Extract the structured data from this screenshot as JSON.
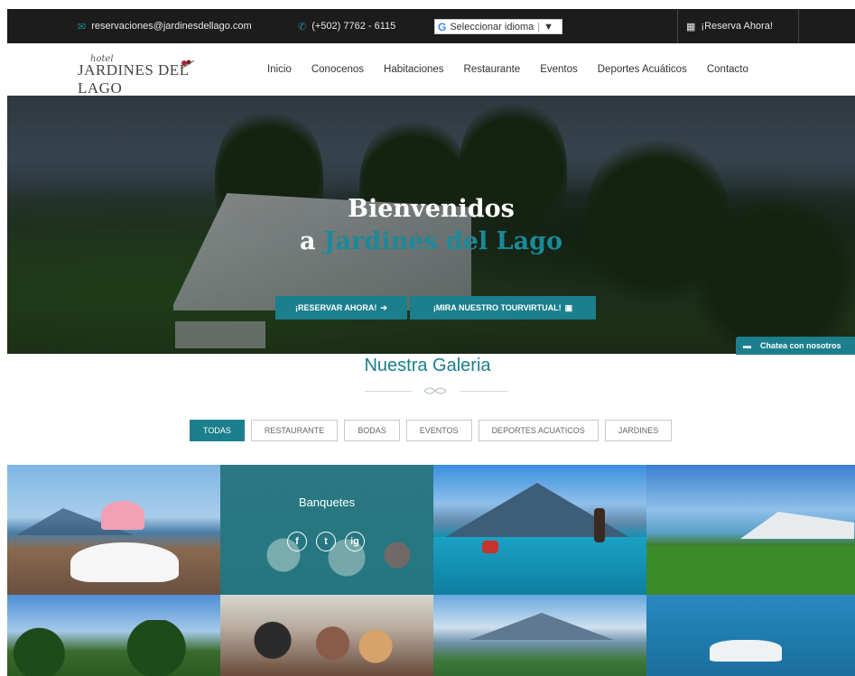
{
  "topbar": {
    "email": "reservaciones@jardinesdellago.com",
    "phone": "(+502) 7762 - 6115",
    "language_select": "Seleccionar idioma",
    "language_g": "G",
    "language_arrow": "▼",
    "reserve": "¡Reserva Ahora!"
  },
  "logo": {
    "script": "hotel",
    "word": "JARDINES DEL LAGO"
  },
  "nav": {
    "items": [
      "Inicio",
      "Conocenos",
      "Habitaciones",
      "Restaurante",
      "Eventos",
      "Deportes Acuáticos",
      "Contacto"
    ]
  },
  "hero": {
    "line1": "Bienvenidos",
    "line2_prefix": "a ",
    "line2_accent": "Jardines del Lago",
    "button_reserve": "¡RESERVAR AHORA!",
    "button_tour": "¡MIRA NUESTRO TOURVIRTUAL!"
  },
  "chat": {
    "label": "Chatea con nosotros"
  },
  "gallery": {
    "title": "Nuestra Galeria",
    "filters": [
      "TODAS",
      "RESTAURANTE",
      "BODAS",
      "EVENTOS",
      "DEPORTES ACUATICOS",
      "JARDINES"
    ],
    "active_filter": "TODAS",
    "hover_caption": "Banquetes",
    "socials": [
      "f",
      "t",
      "ig"
    ]
  },
  "colors": {
    "accent": "#1b7f8d",
    "topbar_bg": "#1c1c1c"
  }
}
